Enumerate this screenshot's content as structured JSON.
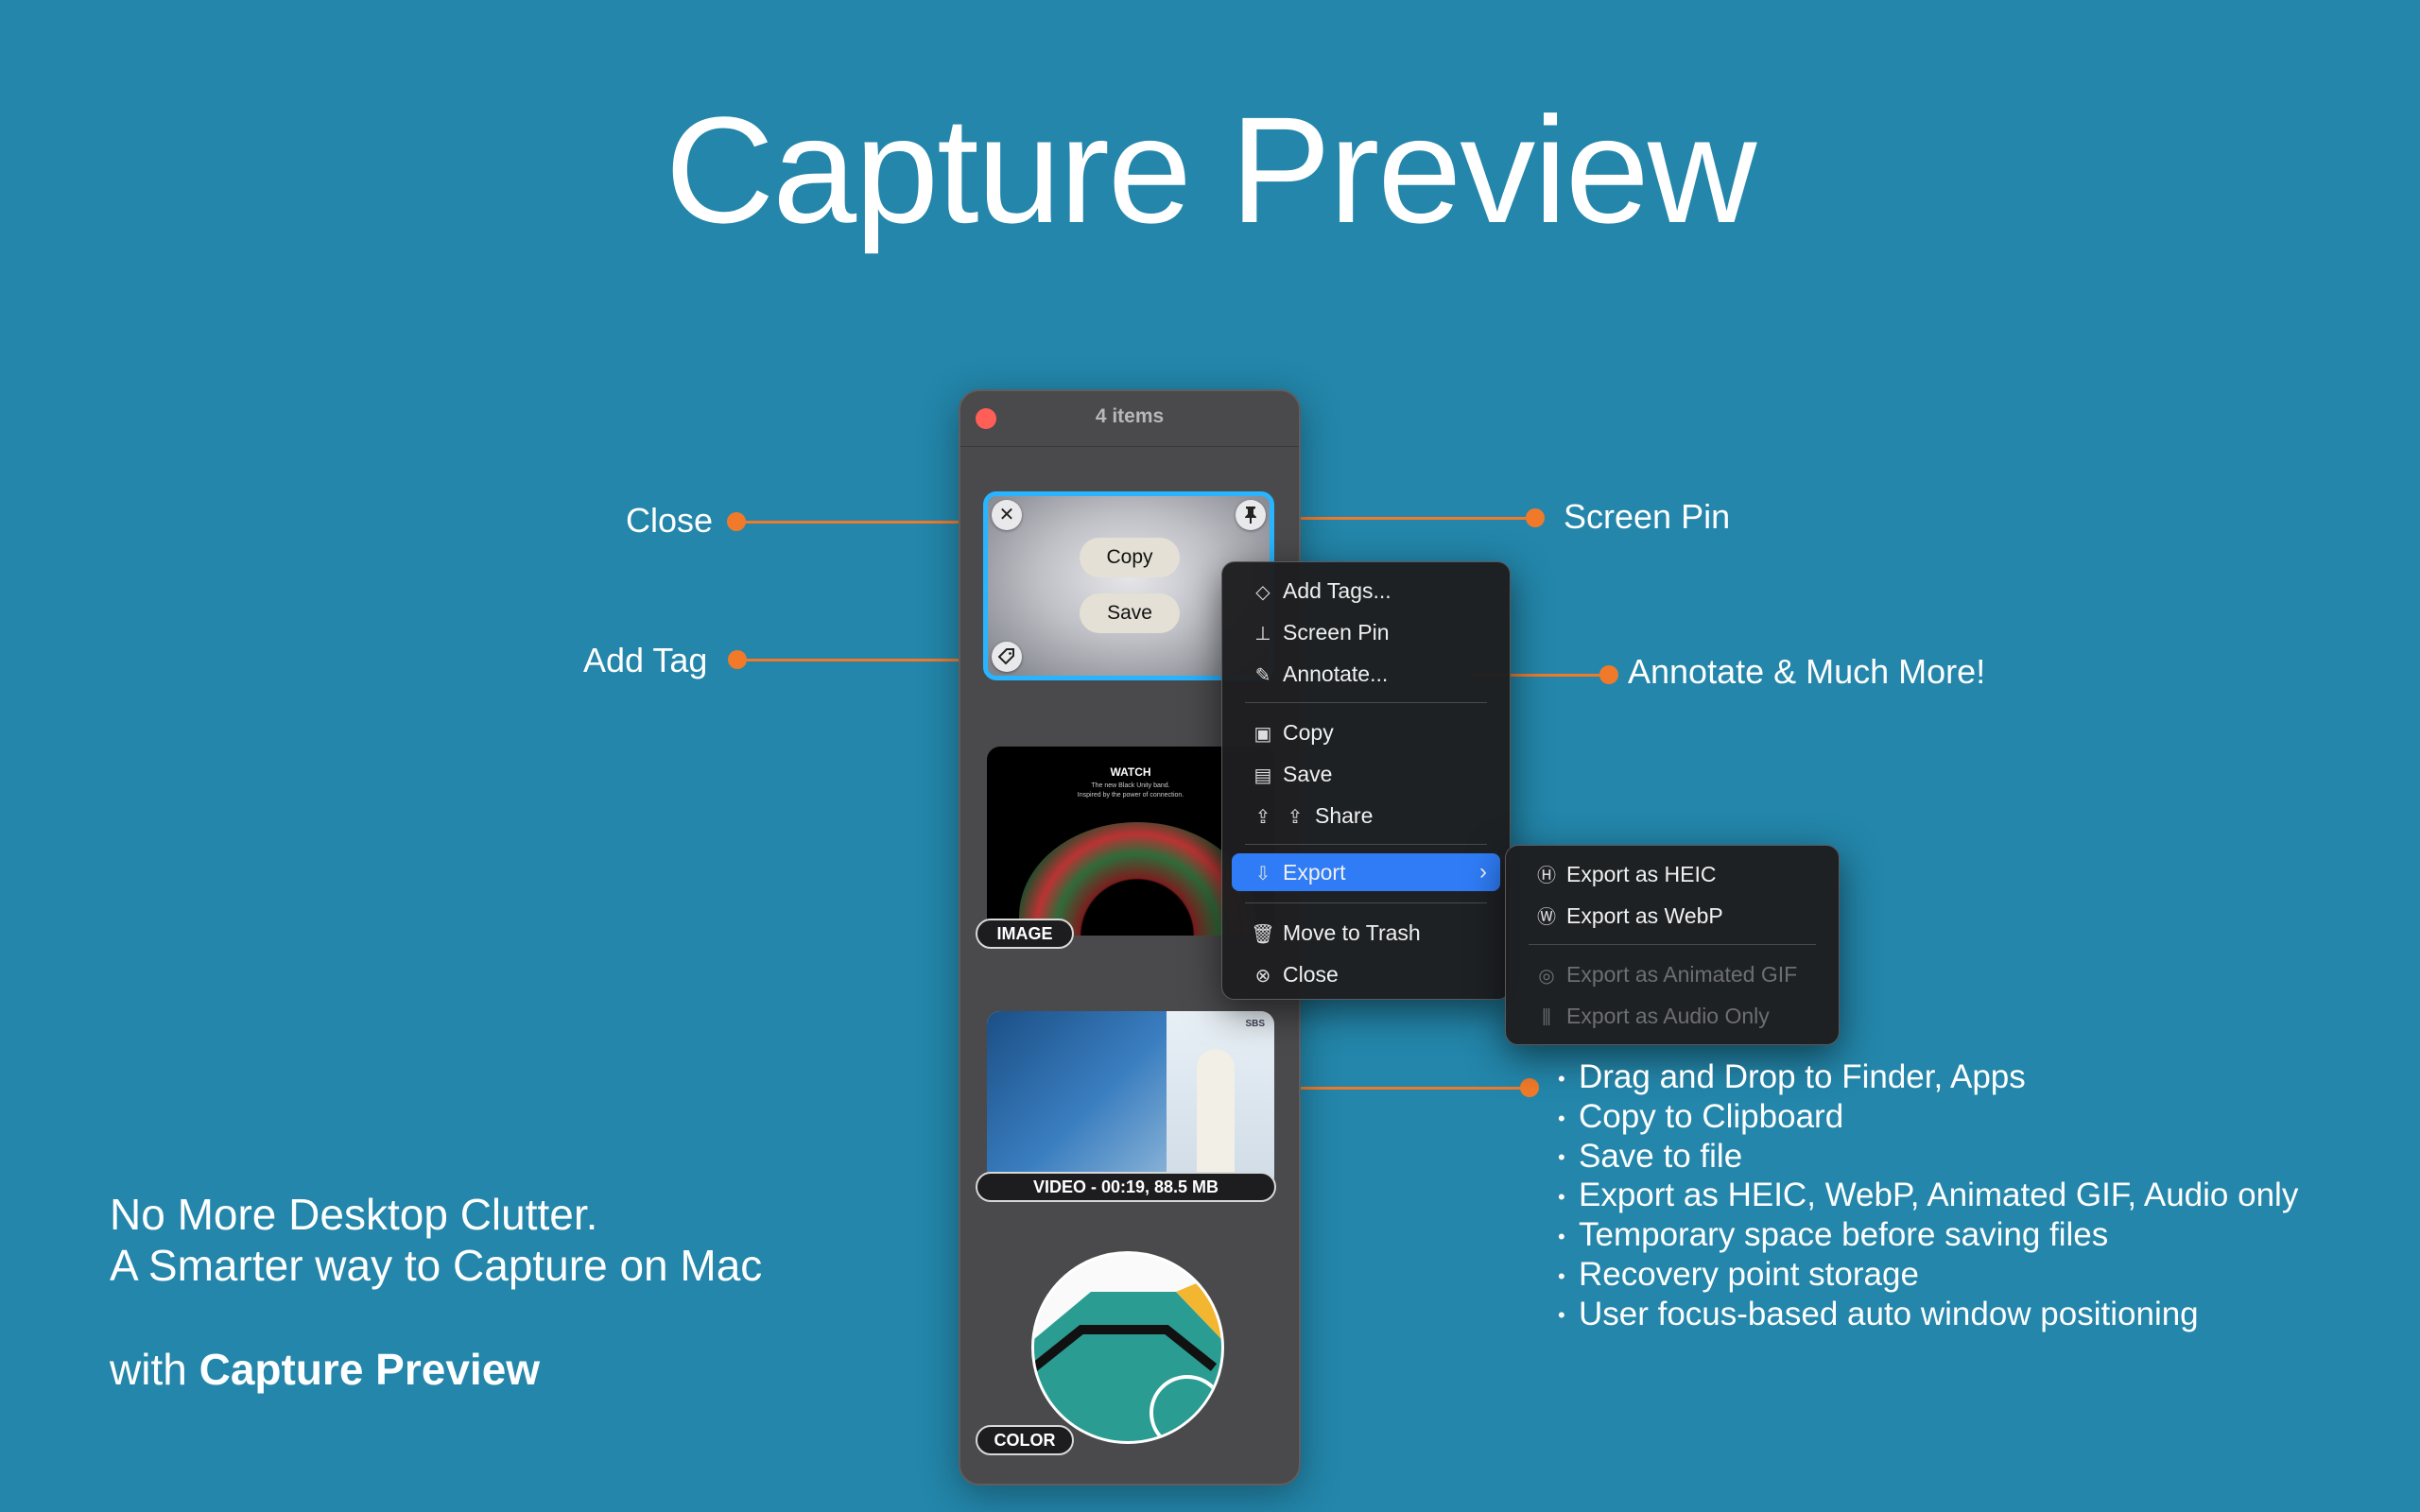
{
  "title": "Capture Preview",
  "panel": {
    "item_count": "4 items",
    "thumb1": {
      "copy_label": "Copy",
      "save_label": "Save"
    },
    "thumb2": {
      "badge": "IMAGE",
      "watch_brand": "WATCH",
      "watch_line1": "The new Black Unity band.",
      "watch_line2": "Inspired by the power of connection."
    },
    "thumb3": {
      "badge": "VIDEO - 00:19, 88.5 MB",
      "logo": "SBS"
    },
    "thumb4": {
      "badge": "COLOR"
    }
  },
  "callouts": {
    "close": "Close",
    "add_tag": "Add Tag",
    "screen_pin": "Screen Pin",
    "annotate": "Annotate & Much More!"
  },
  "menu": {
    "add_tags": "Add Tags...",
    "screen_pin": "Screen Pin",
    "annotate": "Annotate...",
    "copy": "Copy",
    "save": "Save",
    "share": "Share",
    "export": "Export",
    "move_to_trash": "Move to Trash",
    "close": "Close"
  },
  "submenu": {
    "heic": "Export as HEIC",
    "webp": "Export as WebP",
    "gif": "Export as Animated GIF",
    "audio": "Export as Audio Only"
  },
  "features": [
    "Drag and Drop to Finder, Apps",
    "Copy to Clipboard",
    "Save to file",
    "Export as HEIC, WebP, Animated GIF, Audio only",
    "Temporary space before saving files",
    "Recovery point storage",
    "User focus-based auto window positioning"
  ],
  "tagline": {
    "line1": "No More Desktop Clutter.",
    "line2": "A Smarter way to Capture on Mac",
    "with": "with",
    "product": "Capture Preview"
  },
  "colors": {
    "background": "#2386aa",
    "accent_orange": "#f07a2a",
    "selection_blue": "#28b4ff",
    "menu_highlight": "#2f7cf6"
  }
}
